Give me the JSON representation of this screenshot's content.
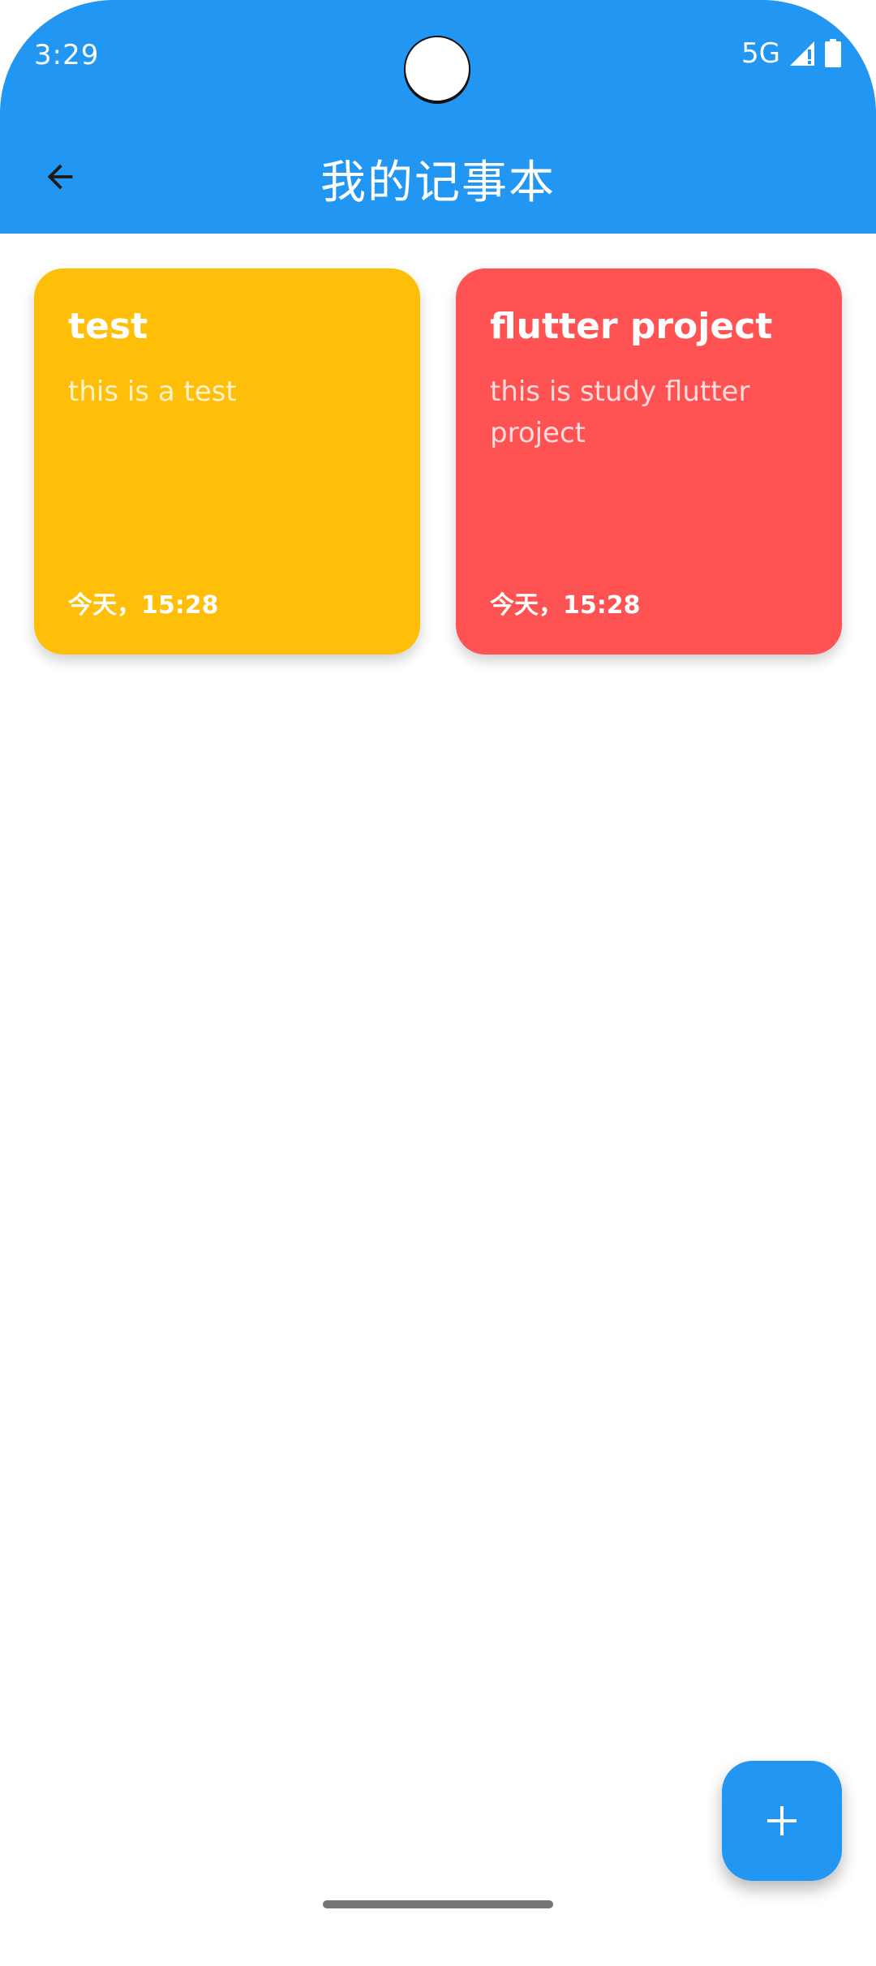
{
  "status_bar": {
    "time": "3:29",
    "network": "5G",
    "icons": [
      "signal-icon",
      "battery-icon"
    ]
  },
  "app_bar": {
    "title": "我的记事本",
    "back_icon": "back-arrow-icon",
    "background_color": "#2296f3"
  },
  "notes": [
    {
      "title": "test",
      "body": "this is a test",
      "time": "今天，15:28",
      "color": "#ffbf08"
    },
    {
      "title": "flutter project",
      "body": "this is study flutter project",
      "time": "今天，15:28",
      "color": "#fe5253"
    }
  ],
  "fab": {
    "icon": "add-icon",
    "color": "#2296f3"
  }
}
